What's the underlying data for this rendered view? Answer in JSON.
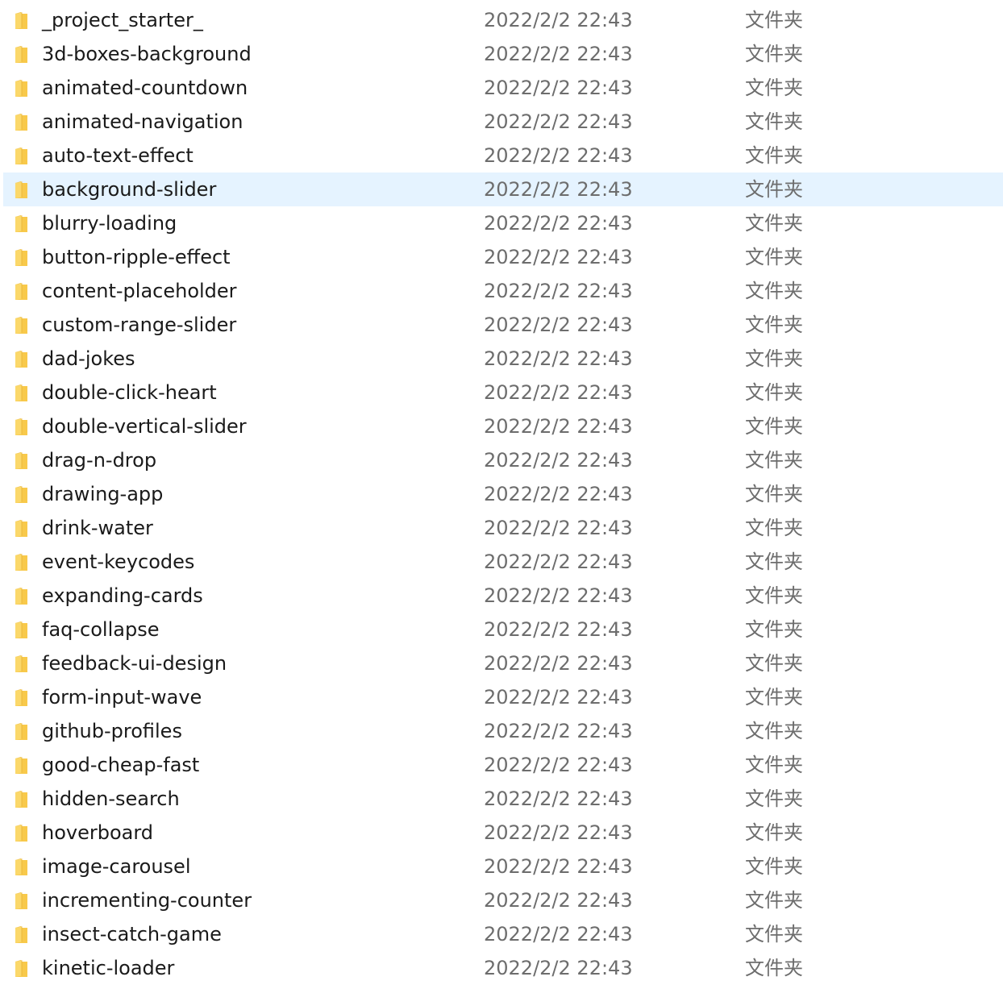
{
  "colors": {
    "selected_row_bg": "#e5f3ff",
    "folder_icon": "#f8c94b",
    "name_text": "#1a1a1a",
    "meta_text": "#6d6d6d"
  },
  "icon": "folder-icon",
  "rows": [
    {
      "name": "_project_starter_",
      "date": "2022/2/2 22:43",
      "type": "文件夹",
      "selected": false
    },
    {
      "name": "3d-boxes-background",
      "date": "2022/2/2 22:43",
      "type": "文件夹",
      "selected": false
    },
    {
      "name": "animated-countdown",
      "date": "2022/2/2 22:43",
      "type": "文件夹",
      "selected": false
    },
    {
      "name": "animated-navigation",
      "date": "2022/2/2 22:43",
      "type": "文件夹",
      "selected": false
    },
    {
      "name": "auto-text-effect",
      "date": "2022/2/2 22:43",
      "type": "文件夹",
      "selected": false
    },
    {
      "name": "background-slider",
      "date": "2022/2/2 22:43",
      "type": "文件夹",
      "selected": true
    },
    {
      "name": "blurry-loading",
      "date": "2022/2/2 22:43",
      "type": "文件夹",
      "selected": false
    },
    {
      "name": "button-ripple-effect",
      "date": "2022/2/2 22:43",
      "type": "文件夹",
      "selected": false
    },
    {
      "name": "content-placeholder",
      "date": "2022/2/2 22:43",
      "type": "文件夹",
      "selected": false
    },
    {
      "name": "custom-range-slider",
      "date": "2022/2/2 22:43",
      "type": "文件夹",
      "selected": false
    },
    {
      "name": "dad-jokes",
      "date": "2022/2/2 22:43",
      "type": "文件夹",
      "selected": false
    },
    {
      "name": "double-click-heart",
      "date": "2022/2/2 22:43",
      "type": "文件夹",
      "selected": false
    },
    {
      "name": "double-vertical-slider",
      "date": "2022/2/2 22:43",
      "type": "文件夹",
      "selected": false
    },
    {
      "name": "drag-n-drop",
      "date": "2022/2/2 22:43",
      "type": "文件夹",
      "selected": false
    },
    {
      "name": "drawing-app",
      "date": "2022/2/2 22:43",
      "type": "文件夹",
      "selected": false
    },
    {
      "name": "drink-water",
      "date": "2022/2/2 22:43",
      "type": "文件夹",
      "selected": false
    },
    {
      "name": "event-keycodes",
      "date": "2022/2/2 22:43",
      "type": "文件夹",
      "selected": false
    },
    {
      "name": "expanding-cards",
      "date": "2022/2/2 22:43",
      "type": "文件夹",
      "selected": false
    },
    {
      "name": "faq-collapse",
      "date": "2022/2/2 22:43",
      "type": "文件夹",
      "selected": false
    },
    {
      "name": "feedback-ui-design",
      "date": "2022/2/2 22:43",
      "type": "文件夹",
      "selected": false
    },
    {
      "name": "form-input-wave",
      "date": "2022/2/2 22:43",
      "type": "文件夹",
      "selected": false
    },
    {
      "name": "github-profiles",
      "date": "2022/2/2 22:43",
      "type": "文件夹",
      "selected": false
    },
    {
      "name": "good-cheap-fast",
      "date": "2022/2/2 22:43",
      "type": "文件夹",
      "selected": false
    },
    {
      "name": "hidden-search",
      "date": "2022/2/2 22:43",
      "type": "文件夹",
      "selected": false
    },
    {
      "name": "hoverboard",
      "date": "2022/2/2 22:43",
      "type": "文件夹",
      "selected": false
    },
    {
      "name": "image-carousel",
      "date": "2022/2/2 22:43",
      "type": "文件夹",
      "selected": false
    },
    {
      "name": "incrementing-counter",
      "date": "2022/2/2 22:43",
      "type": "文件夹",
      "selected": false
    },
    {
      "name": "insect-catch-game",
      "date": "2022/2/2 22:43",
      "type": "文件夹",
      "selected": false
    },
    {
      "name": "kinetic-loader",
      "date": "2022/2/2 22:43",
      "type": "文件夹",
      "selected": false
    }
  ]
}
